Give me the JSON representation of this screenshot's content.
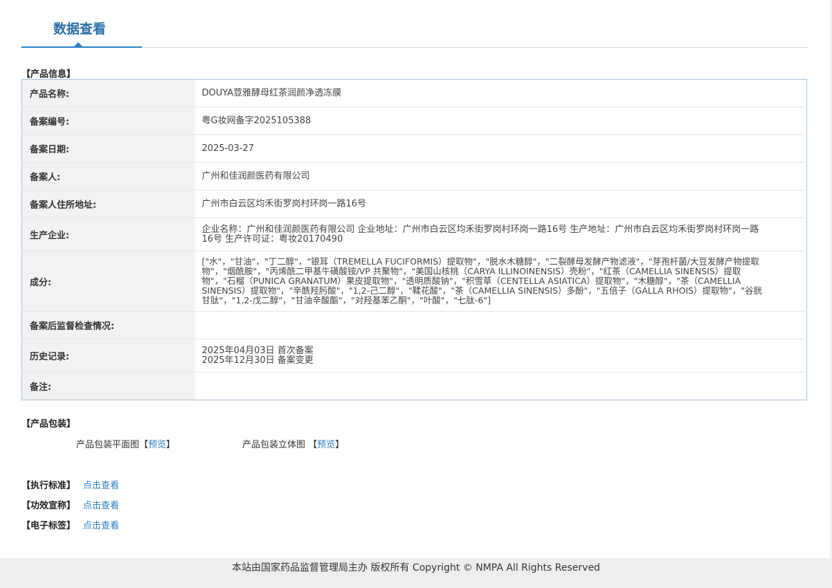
{
  "tab": {
    "title": "数据查看"
  },
  "sections": {
    "product_info": "【产品信息】",
    "product_package": "【产品包装】",
    "exec_standard": "【执行标准】",
    "efficacy_claim": "【功效宣称】",
    "e_label": "【电子标签】"
  },
  "rows": [
    {
      "label": "产品名称:",
      "value": "DOUYA荳雅酵母红茶润颜净透冻膜"
    },
    {
      "label": "备案编号:",
      "value": "粤G妆网备字2025105388"
    },
    {
      "label": "备案日期:",
      "value": "2025-03-27"
    },
    {
      "label": "备案人:",
      "value": "广州和佳润颜医药有限公司"
    },
    {
      "label": "备案人住所地址:",
      "value": "广州市白云区均禾街罗岗村环岗一路16号"
    },
    {
      "label": "生产企业:",
      "value": "企业名称：广州和佳润颜医药有限公司 企业地址：广州市白云区均禾街罗岗村环岗一路16号 生产地址：广州市白云区均禾街罗岗村环岗一路16号 生产许可证：粤妆20170490"
    },
    {
      "label": "成分:",
      "value": "[\"水\"，\"甘油\"，\"丁二醇\"，\"银耳（TREMELLA FUCIFORMIS）提取物\"，\"脱水木糖醇\"，\"二裂酵母发酵产物滤液\"，\"芽孢杆菌/大豆发酵产物提取物\"，\"烟酰胺\"，\"丙烯酰二甲基牛磺酸铵/VP 共聚物\"，\"美国山核桃（CARYA ILLINOINENSIS）壳粉\"，\"红茶（CAMELLIA SINENSIS）提取物\"，\"石榴（PUNICA GRANATUM）果皮提取物\"，\"透明质酸钠\"，\"积雪草（CENTELLA ASIATICA）提取物\"，\"木糖醇\"，\"茶（CAMELLIA SINENSIS）提取物\"，\"辛酰羟肟酸\"，\"1,2-己二醇\"，\"鞣花酸\"，\"茶（CAMELLIA SINENSIS）多酚\"，\"五倍子（GALLA RHOIS）提取物\"，\"谷胱甘肽\"，\"1,2-戊二醇\"，\"甘油辛酸酯\"，\"对羟基苯乙酮\"，\"叶酸\"，\"七肽-6\"]"
    },
    {
      "label": "备案后监督检查情况:",
      "value": ""
    },
    {
      "label": "历史记录:",
      "history": [
        "2025年04月03日 首次备案",
        "2025年12月30日 备案变更"
      ]
    },
    {
      "label": "备注:",
      "value": ""
    }
  ],
  "package": {
    "flat_label": "产品包装平面图",
    "solid_label": "产品包装立体图",
    "bracket_open": "【",
    "bracket_close": "】",
    "preview": "预览"
  },
  "links": {
    "view": "点击查看"
  },
  "footer": {
    "text": "本站由国家药品监督管理局主办 版权所有 Copyright © NMPA All Rights Reserved"
  }
}
